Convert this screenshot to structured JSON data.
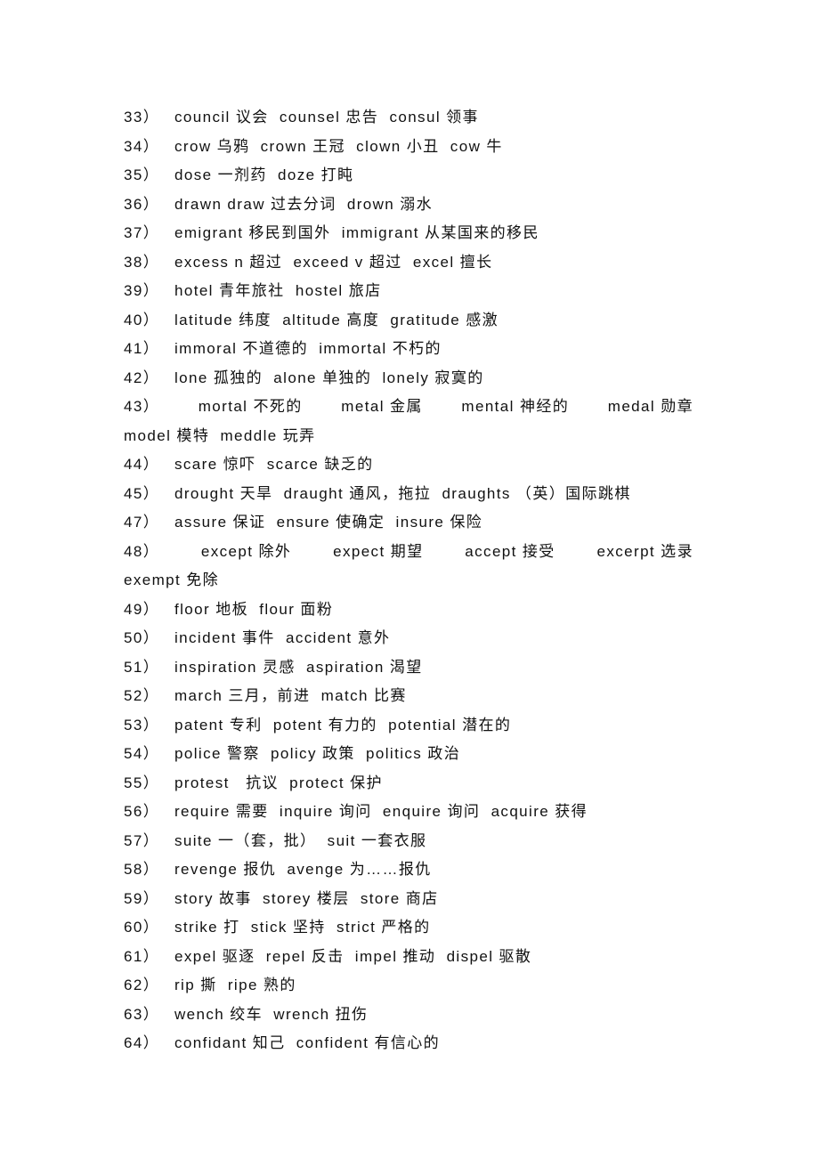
{
  "document": {
    "lines": [
      {
        "num": "33）",
        "text": "council 议会  counsel 忠告  consul 领事"
      },
      {
        "num": "34）",
        "text": "crow 乌鸦  crown 王冠  clown 小丑  cow 牛"
      },
      {
        "num": "35）",
        "text": "dose 一剂药  doze 打盹"
      },
      {
        "num": "36）",
        "text": "drawn draw 过去分词  drown 溺水"
      },
      {
        "num": "37）",
        "text": "emigrant 移民到国外  immigrant 从某国来的移民"
      },
      {
        "num": "38）",
        "text": "excess n 超过  exceed v 超过  excel 擅长"
      },
      {
        "num": "39）",
        "text": "hotel 青年旅社  hostel 旅店"
      },
      {
        "num": "40）",
        "text": "latitude 纬度  altitude 高度  gratitude 感激"
      },
      {
        "num": "41）",
        "text": "immoral 不道德的  immortal 不朽的"
      },
      {
        "num": "42）",
        "text": "lone 孤独的  alone 单独的  lonely 寂寞的"
      },
      {
        "num": "43）",
        "parts": [
          "mortal 不死的",
          "metal 金属",
          "mental 神经的",
          "medal 勋章"
        ]
      },
      {
        "num": "",
        "text": "model 模特  meddle 玩弄"
      },
      {
        "num": "44）",
        "text": "scare 惊吓  scarce 缺乏的"
      },
      {
        "num": "45）",
        "text": "drought 天旱  draught 通风，拖拉  draughts （英）国际跳棋"
      },
      {
        "num": "47）",
        "text": "assure 保证  ensure 使确定  insure 保险"
      },
      {
        "num": "48）",
        "parts": [
          "except 除外",
          "expect 期望",
          "accept 接受",
          "excerpt 选录"
        ]
      },
      {
        "num": "",
        "text": "exempt 免除"
      },
      {
        "num": "49）",
        "text": "floor 地板  flour 面粉"
      },
      {
        "num": "50）",
        "text": "incident 事件  accident 意外"
      },
      {
        "num": "51）",
        "text": "inspiration 灵感  aspiration 渴望"
      },
      {
        "num": "52）",
        "text": "march 三月，前进  match 比赛"
      },
      {
        "num": "53）",
        "text": "patent 专利  potent 有力的  potential 潜在的"
      },
      {
        "num": "54）",
        "text": "police 警察  policy 政策  politics 政治"
      },
      {
        "num": "55）",
        "text": "protest   抗议  protect 保护"
      },
      {
        "num": "56）",
        "text": "require 需要  inquire 询问  enquire 询问  acquire 获得"
      },
      {
        "num": "57）",
        "text": "suite 一（套，批）  suit 一套衣服"
      },
      {
        "num": "58）",
        "text": "revenge 报仇  avenge 为……报仇"
      },
      {
        "num": "59）",
        "text": "story 故事  storey 楼层  store 商店"
      },
      {
        "num": "60）",
        "text": "strike 打  stick 坚持  strict 严格的"
      },
      {
        "num": "61）",
        "text": "expel 驱逐  repel 反击  impel 推动  dispel 驱散"
      },
      {
        "num": "62）",
        "text": "rip 撕  ripe 熟的"
      },
      {
        "num": "63）",
        "text": "wench 绞车  wrench 扭伤"
      },
      {
        "num": "64）",
        "text": "confidant 知己  confident 有信心的"
      }
    ]
  }
}
